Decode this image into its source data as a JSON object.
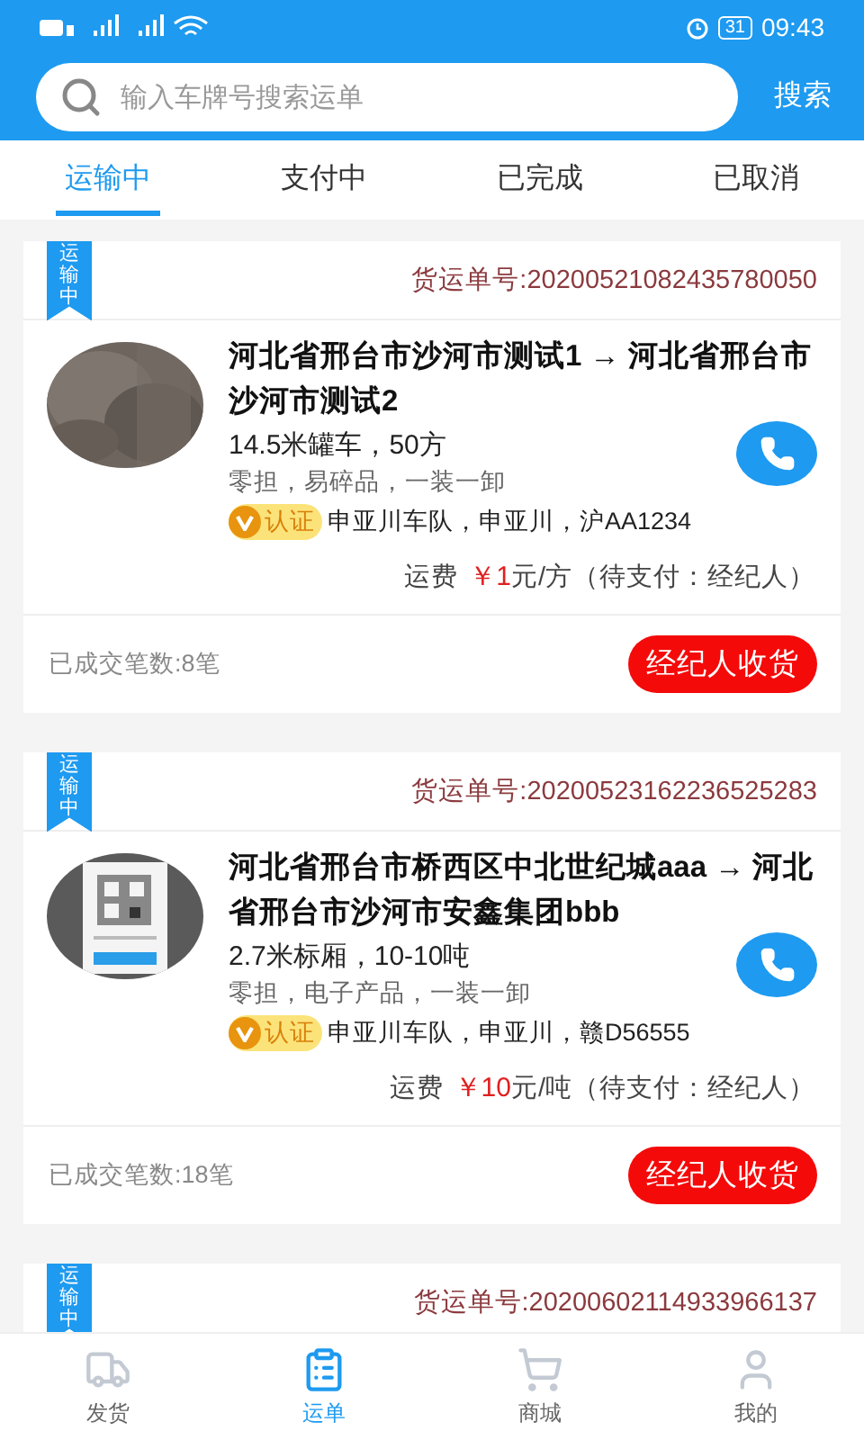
{
  "status_bar": {
    "time": "09:43",
    "battery": "31"
  },
  "search": {
    "placeholder": "输入车牌号搜索运单",
    "button": "搜索"
  },
  "tabs": [
    {
      "label": "运输中",
      "selected": true
    },
    {
      "label": "支付中",
      "selected": false
    },
    {
      "label": "已完成",
      "selected": false
    },
    {
      "label": "已取消",
      "selected": false
    }
  ],
  "orders": [
    {
      "status_tag": "运输中",
      "order_no": "货运单号:20200521082435780050",
      "route": "河北省邢台市沙河市测试1 → 河北省邢台市沙河市测试2",
      "vehicle": "14.5米罐车，50方",
      "cargo": "零担，易碎品，一装一卸",
      "verified": true,
      "verify_label": "认证",
      "carrier": "申亚川车队，申亚川，沪AA1234",
      "fee_label": "运费",
      "fee_amount": "￥1",
      "fee_unit": "元/方（待支付：经纪人）",
      "deal_count": "已成交笔数:8笔",
      "action": "经纪人收货"
    },
    {
      "status_tag": "运输中",
      "order_no": "货运单号:20200523162236525283",
      "route": "河北省邢台市桥西区中北世纪城aaa → 河北省邢台市沙河市安鑫集团bbb",
      "vehicle": "2.7米标厢，10-10吨",
      "cargo": "零担，电子产品，一装一卸",
      "verified": true,
      "verify_label": "认证",
      "carrier": "申亚川车队，申亚川，赣D56555",
      "fee_label": "运费",
      "fee_amount": "￥10",
      "fee_unit": "元/吨（待支付：经纪人）",
      "deal_count": "已成交笔数:18笔",
      "action": "经纪人收货"
    },
    {
      "status_tag": "运输中",
      "order_no": "货运单号:20200602114933966137"
    }
  ],
  "bottom_nav": [
    {
      "label": "发货",
      "kind": "truck",
      "selected": false
    },
    {
      "label": "运单",
      "kind": "clipboard",
      "selected": true
    },
    {
      "label": "商城",
      "kind": "cart",
      "selected": false
    },
    {
      "label": "我的",
      "kind": "user",
      "selected": false
    }
  ]
}
